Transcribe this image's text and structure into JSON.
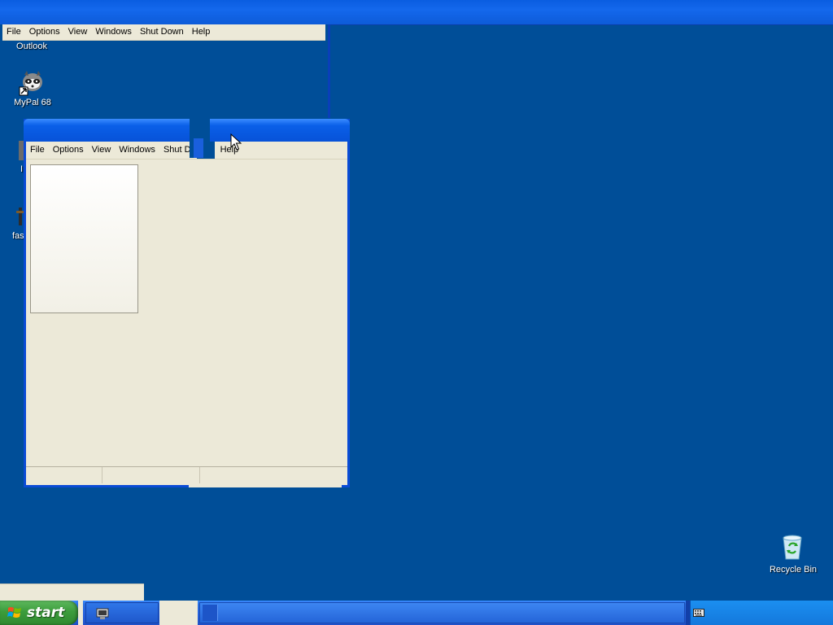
{
  "background_window": {
    "menu": [
      "File",
      "Options",
      "View",
      "Windows",
      "Shut Down",
      "Help"
    ]
  },
  "desktop_icons": {
    "outlook_label": "Outlook",
    "mypal_label": "MyPal 68",
    "partial_label_1": "I",
    "partial_label_2": "fas",
    "recycle_bin_label": "Recycle Bin"
  },
  "front_window": {
    "menu_left": [
      "File",
      "Options",
      "View",
      "Windows",
      "Shut D"
    ],
    "menu_right": [
      "Help"
    ]
  },
  "taskbar": {
    "start_label": "start"
  },
  "colors": {
    "desktop": "#004e98",
    "menubar": "#ece9d8",
    "start_green": "#3c9c3c",
    "taskbar_blue": "#245edb"
  }
}
